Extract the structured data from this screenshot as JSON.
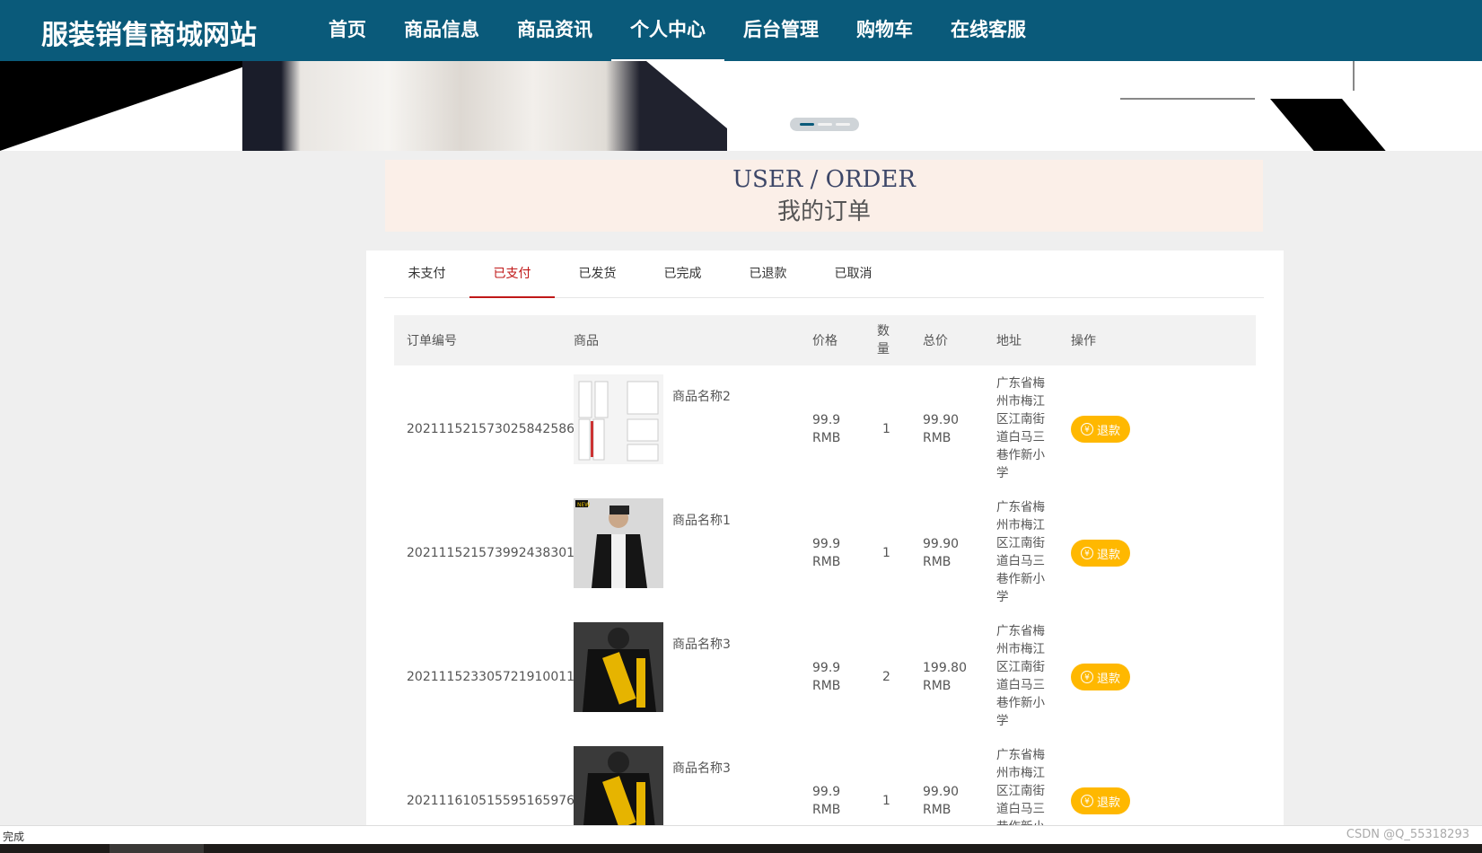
{
  "site": {
    "brand": "服装销售商城网站"
  },
  "nav": [
    "首页",
    "商品信息",
    "商品资讯",
    "个人中心",
    "后台管理",
    "购物车",
    "在线客服"
  ],
  "nav_active": "个人中心",
  "section": {
    "en": "USER / ORDER",
    "zh": "我的订单"
  },
  "tabs": [
    "未支付",
    "已支付",
    "已发货",
    "已完成",
    "已退款",
    "已取消"
  ],
  "tab_active": "已支付",
  "table": {
    "headers": {
      "order_no": "订单编号",
      "product": "商品",
      "price": "价格",
      "qty": "数量",
      "total": "总价",
      "address": "地址",
      "action": "操作"
    },
    "rows": [
      {
        "order_no": "20211152157302584258​6",
        "product": "商品名称2",
        "price": "99.9 RMB",
        "qty": "1",
        "total": "99.90 RMB",
        "address": "广东省梅州市梅江区江南街道白马三巷作新小学",
        "action": "退款",
        "image": "white-tracksuit"
      },
      {
        "order_no": "20211152157399243830​1",
        "product": "商品名称1",
        "price": "99.9 RMB",
        "qty": "1",
        "total": "99.90 RMB",
        "address": "广东省梅州市梅江区江南街道白马三巷作新小学",
        "action": "退款",
        "image": "black-jacket"
      },
      {
        "order_no": "20211152330572191001​1",
        "product": "商品名称3",
        "price": "99.9 RMB",
        "qty": "2",
        "total": "199.80 RMB",
        "address": "广东省梅州市梅江区江南街道白马三巷作新小学",
        "action": "退款",
        "image": "black-yellow-hoodie"
      },
      {
        "order_no": "20211161051559516597​6",
        "product": "商品名称3",
        "price": "99.9 RMB",
        "qty": "1",
        "total": "99.90 RMB",
        "address": "广东省梅州市梅江区江南街道白马三巷作新小",
        "action": "退款",
        "image": "black-yellow-hoodie"
      }
    ]
  },
  "status": {
    "text": "完成",
    "watermark": "CSDN @Q_55318293"
  },
  "colors": {
    "nav_bg": "#0a5a7a",
    "accent": "#c01818",
    "refund": "#ffb800"
  }
}
